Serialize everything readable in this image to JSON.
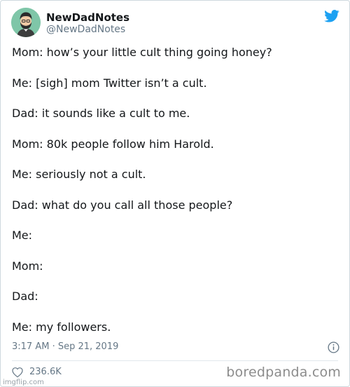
{
  "tweet": {
    "author": {
      "display_name": "NewDadNotes",
      "handle": "@NewDadNotes",
      "avatar_icon": "bearded-man-avatar-icon"
    },
    "brand_icon": "twitter-bird-icon",
    "lines": [
      "Mom: how’s your little cult thing going honey?",
      "Me: [sigh] mom Twitter isn’t a cult.",
      "Dad: it sounds like a cult to me.",
      "Mom: 80k people follow him Harold.",
      "Me: seriously not a cult.",
      "Dad: what do you call all those people?",
      "Me:",
      "Mom:",
      "Dad:",
      "Me: my followers."
    ],
    "timestamp": "3:17 AM · Sep 21, 2019",
    "info_icon": "info-icon",
    "likes": "236.6K",
    "like_icon": "heart-icon"
  },
  "colors": {
    "twitter_blue": "#1da1f2",
    "text_primary": "#14171a",
    "text_secondary": "#657786",
    "avatar_bg": "#7fc6a8"
  },
  "overlay": {
    "watermark": "imgflip.com",
    "brand": "boredpanda.com"
  }
}
